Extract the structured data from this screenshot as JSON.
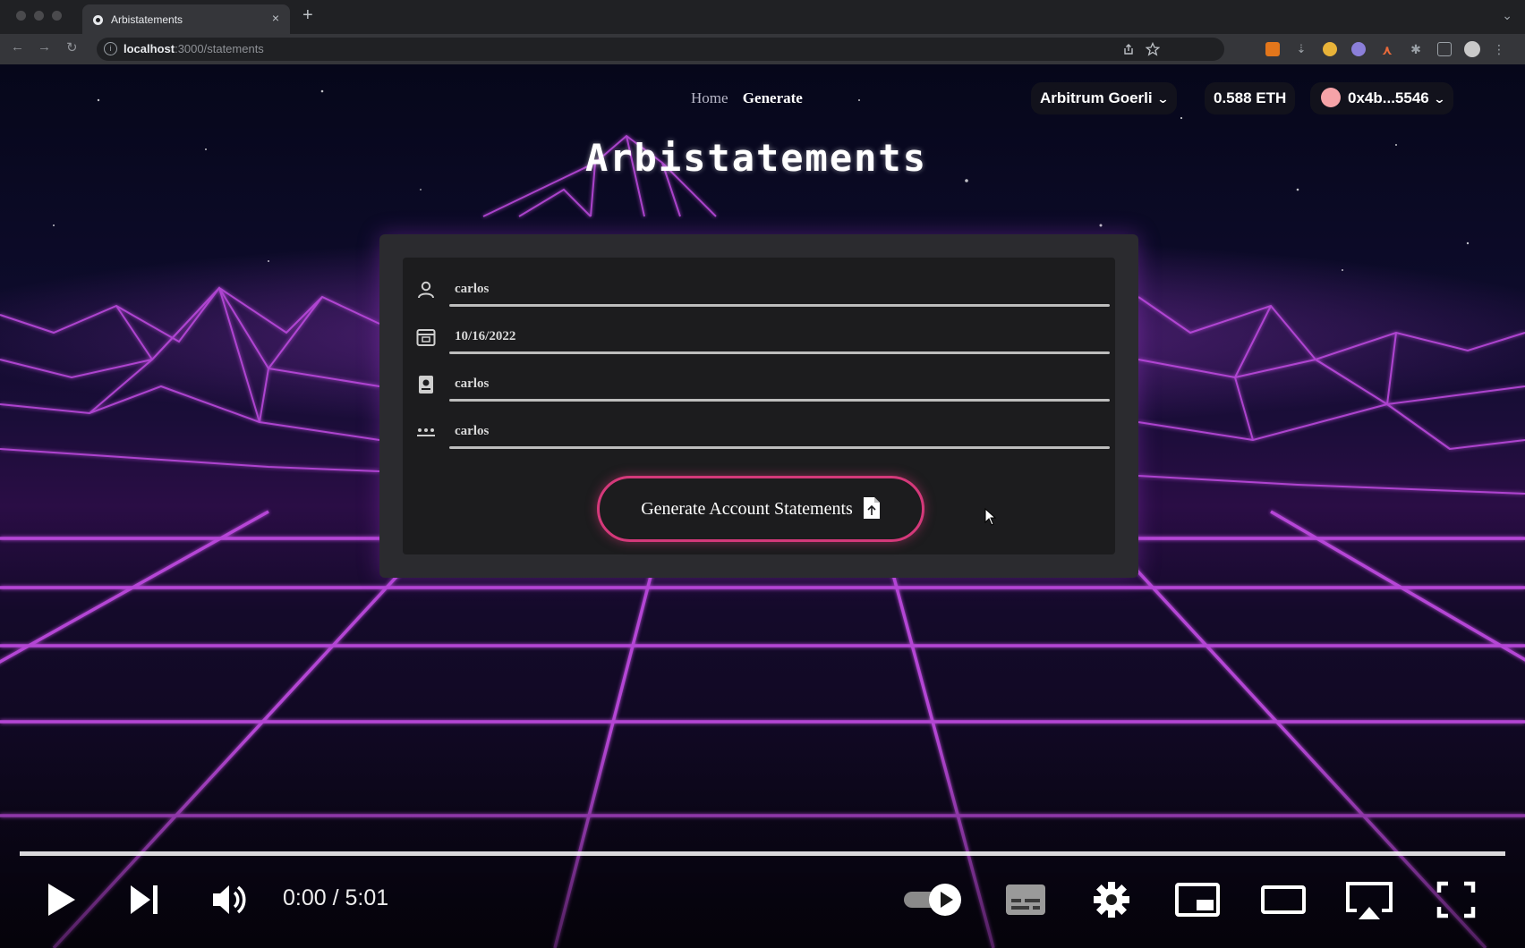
{
  "browser": {
    "tab_title": "Arbistatements",
    "close_tab": "×",
    "new_tab": "+",
    "url_host": "localhost",
    "url_path": ":3000/statements"
  },
  "nav": {
    "home": "Home",
    "generate": "Generate"
  },
  "wallet": {
    "network": "Arbitrum Goerli",
    "balance": "0.588 ETH",
    "account": "0x4b...5546"
  },
  "app": {
    "title": "Arbistatements"
  },
  "form": {
    "fields": [
      {
        "icon": "user-icon",
        "value": "carlos"
      },
      {
        "icon": "calendar-icon",
        "value": "10/16/2022"
      },
      {
        "icon": "id-card-icon",
        "value": "carlos"
      },
      {
        "icon": "password-dots-icon",
        "value": "carlos"
      }
    ],
    "submit_label": "Generate Account Statements",
    "submit_icon": "document-icon"
  },
  "player": {
    "time": "0:00 / 5:01",
    "progress": 0.0,
    "autoplay": true
  },
  "colors": {
    "accent": "#d4397a",
    "grid": "#c040e8",
    "card": "#1c1c1e"
  }
}
